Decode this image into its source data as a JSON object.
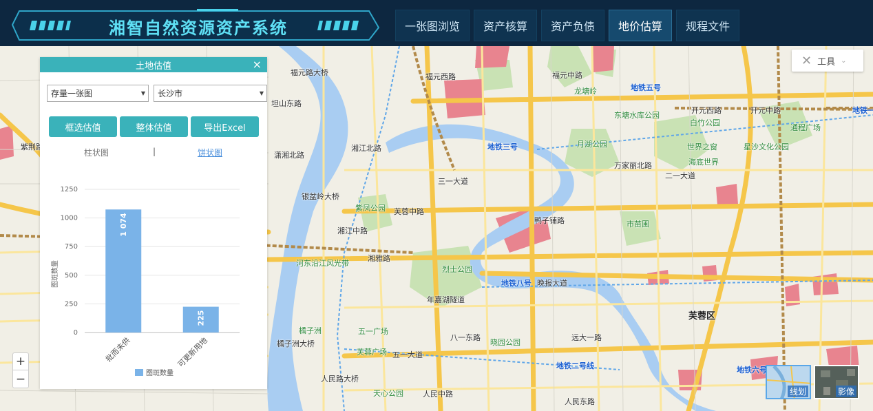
{
  "header": {
    "app_title": "湘智自然资源资产系统",
    "nav": [
      {
        "label": "一张图浏览",
        "active": false
      },
      {
        "label": "资产核算",
        "active": false
      },
      {
        "label": "资产负债",
        "active": false
      },
      {
        "label": "地价估算",
        "active": true
      },
      {
        "label": "规程文件",
        "active": false
      }
    ]
  },
  "tools": {
    "label": "工具"
  },
  "zoom": {
    "in": "+",
    "out": "−"
  },
  "basemap": {
    "line_label": "线划",
    "image_label": "影像"
  },
  "panel": {
    "title": "土地估值",
    "close": "×",
    "select_type": "存量一张图",
    "select_city": "长沙市",
    "buttons": {
      "box": "框选估值",
      "whole": "整体估值",
      "export": "导出Excel"
    },
    "tabs": {
      "bar": "柱状图",
      "sep": "|",
      "pie": "饼状图"
    }
  },
  "chart_data": {
    "type": "bar",
    "categories": [
      "批而未供",
      "可更新用地"
    ],
    "values": [
      1074,
      225
    ],
    "value_labels": [
      "1 074",
      "225"
    ],
    "ylabel": "图斑数量",
    "yticks": [
      0,
      250,
      500,
      750,
      1000,
      1250
    ],
    "ylim": [
      0,
      1250
    ],
    "legend": [
      "图斑数量"
    ],
    "legend_position": "bottom",
    "color": "#7ab3e8",
    "grid": true
  },
  "map_labels": {
    "roads": [
      "福元西路",
      "福元路大桥",
      "福元中路",
      "坦山东路",
      "开元西路",
      "开元中路",
      "二一大道",
      "三一大道",
      "银盆岭大桥",
      "湘雅路",
      "五一大道",
      "八一东路",
      "远大一路",
      "晚报大道",
      "人民中路",
      "人民东路",
      "人民路大桥",
      "橘子洲大桥",
      "年嘉湖隧道",
      "芙蓉中路",
      "万家丽北路",
      "鸭子铺路",
      "湘江北路",
      "湘江中路",
      "潇湘北路",
      "紫荆路"
    ],
    "metro": [
      "地铁五号",
      "地铁三号",
      "地铁八号",
      "地铁二号线",
      "地铁六号",
      "地铁一号"
    ],
    "parks": [
      "东塘水库公园",
      "白竹公园",
      "月湖公园",
      "世界之窗",
      "星沙文化公园",
      "海底世界",
      "市苗圃",
      "烈士公园",
      "晓园公园",
      "五一广场",
      "芙蓉广场",
      "天心公园",
      "河东沿江风光带",
      "紫凤公园",
      "龙塘岭",
      "通程广场",
      "橘子洲"
    ],
    "districts": [
      "芙蓉区"
    ]
  }
}
